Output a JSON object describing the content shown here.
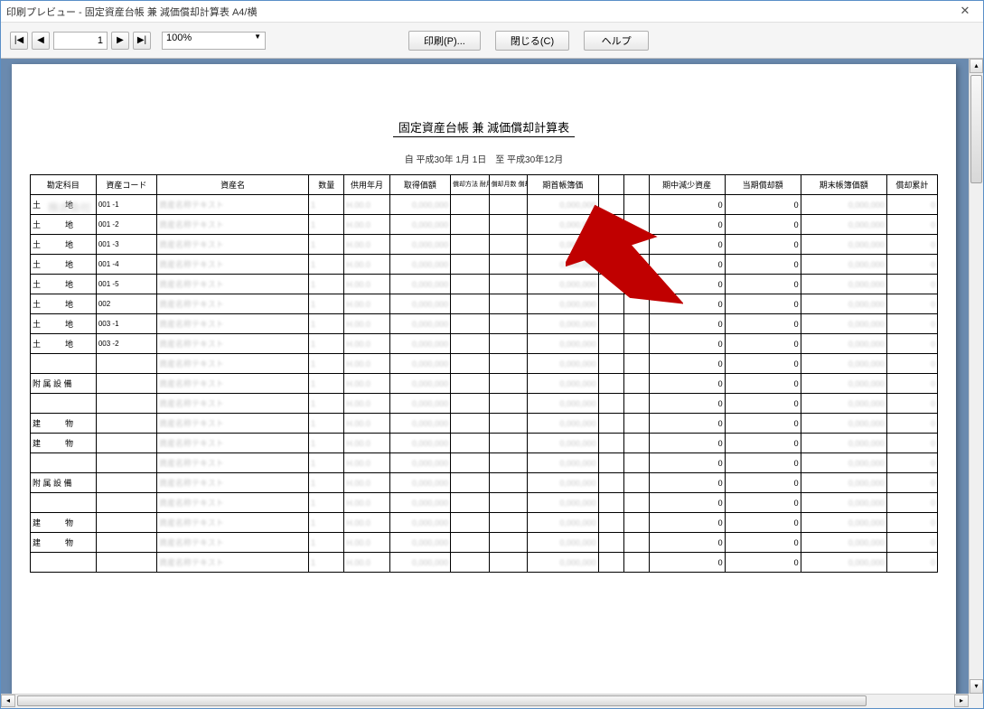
{
  "window": {
    "title": "印刷プレビュー - 固定資産台帳 兼 減価償却計算表 A4/横"
  },
  "toolbar": {
    "page": "1",
    "zoom": "100%",
    "print_label": "印刷(P)...",
    "close_label": "閉じる(C)",
    "help_label": "ヘルプ"
  },
  "report": {
    "title": "固定資産台帳 兼 減価償却計算表",
    "period": "自 平成30年 1月 1日　至 平成30年12月"
  },
  "columns": [
    "勘定科目",
    "資産コード",
    "資産名",
    "数量",
    "供用年月",
    "取得価額",
    "償却方法 耐用年数",
    "償却月数 償却率",
    "期首帳簿価",
    "",
    "",
    "期中減少資産",
    "当期償却額",
    "期末帳簿価額",
    "償却累計"
  ],
  "rows": [
    {
      "account": "土　　　地",
      "code": "001 -1",
      "mid": "0",
      "dec": "0",
      "cur": "0"
    },
    {
      "account": "土　　　地",
      "code": "001 -2",
      "mid": "0",
      "dec": "0",
      "cur": "0"
    },
    {
      "account": "土　　　地",
      "code": "001 -3",
      "mid": "0",
      "dec": "0",
      "cur": "0"
    },
    {
      "account": "土　　　地",
      "code": "001 -4",
      "mid": "0",
      "dec": "0",
      "cur": "0"
    },
    {
      "account": "土　　　地",
      "code": "001 -5",
      "mid": "0",
      "dec": "0",
      "cur": "0"
    },
    {
      "account": "土　　　地",
      "code": "002",
      "mid": "0",
      "dec": "0",
      "cur": "0"
    },
    {
      "account": "土　　　地",
      "code": "003 -1",
      "mid": "0",
      "dec": "0",
      "cur": "0"
    },
    {
      "account": "土　　　地",
      "code": "003 -2",
      "mid": "0",
      "dec": "0",
      "cur": "0"
    },
    {
      "account": "",
      "code": "",
      "mid": "0",
      "dec": "0",
      "cur": ""
    },
    {
      "account": "附 属 設 備",
      "code": "",
      "mid": "0",
      "dec": "0",
      "cur": ""
    },
    {
      "account": "",
      "code": "",
      "mid": "0",
      "dec": "0",
      "cur": ""
    },
    {
      "account": "建　　　物",
      "code": "",
      "mid": "0",
      "dec": "0",
      "cur": ""
    },
    {
      "account": "建　　　物",
      "code": "",
      "mid": "0",
      "dec": "0",
      "cur": "0"
    },
    {
      "account": "",
      "code": "",
      "mid": "0",
      "dec": "0",
      "cur": ""
    },
    {
      "account": "附 属 設 備",
      "code": "",
      "mid": "0",
      "dec": "0",
      "cur": ""
    },
    {
      "account": "",
      "code": "",
      "mid": "0",
      "dec": "0",
      "cur": ""
    },
    {
      "account": "建　　　物",
      "code": "",
      "mid": "0",
      "dec": "0",
      "cur": "0"
    },
    {
      "account": "建　　　物",
      "code": "",
      "mid": "0",
      "dec": "0",
      "cur": "0"
    },
    {
      "account": "",
      "code": "",
      "mid": "0",
      "dec": "0",
      "cur": "0"
    }
  ]
}
